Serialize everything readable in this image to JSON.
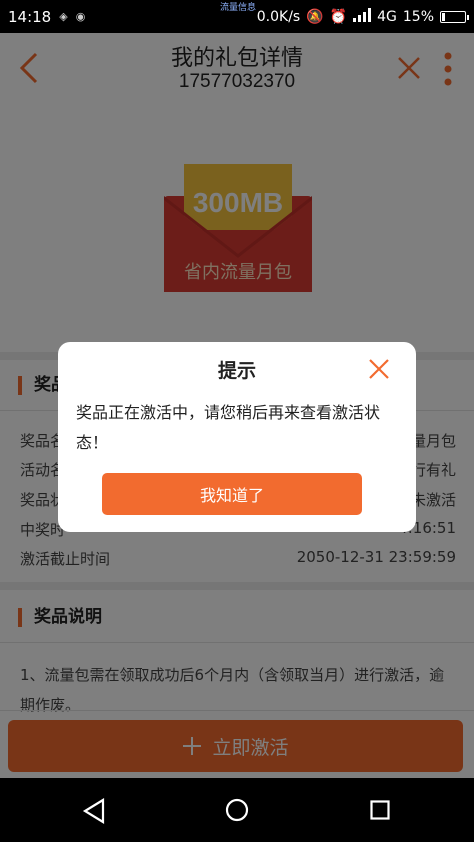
{
  "status_bar": {
    "time": "14:18",
    "left_icons_text": "⚠",
    "center_text": "流量信息",
    "net_speed": "0.0K/s",
    "network": "4G",
    "battery": "15%",
    "battery_level": 0.15
  },
  "header": {
    "title": "我的礼包详情",
    "phone": "17577032370"
  },
  "banner": {
    "amount": "300MB",
    "name": "省内流量月包"
  },
  "prize_section": {
    "title": "奖品",
    "rows": [
      {
        "label": "奖品名",
        "value": "量月包"
      },
      {
        "label": "活动名",
        "value": "行有礼"
      },
      {
        "label": "奖品状",
        "value": "未激活"
      },
      {
        "label": "中奖时",
        "value": "4:16:51"
      },
      {
        "label": "激活截止时间",
        "value": "2050-12-31 23:59:59"
      }
    ]
  },
  "desc_section": {
    "title": "奖品说明",
    "text": "1、流量包需在领取成功后6个月内（含领取当月）进行激活，逾期作废。"
  },
  "activate_button": {
    "label": "立即激活"
  },
  "dialog": {
    "title": "提示",
    "message": "奖品正在激活中，请您稍后再来查看激活状态！",
    "button": "我知道了"
  },
  "colors": {
    "accent": "#f26b2f",
    "envelope_red": "#d93a33",
    "card_gold": "#f4c23c"
  }
}
